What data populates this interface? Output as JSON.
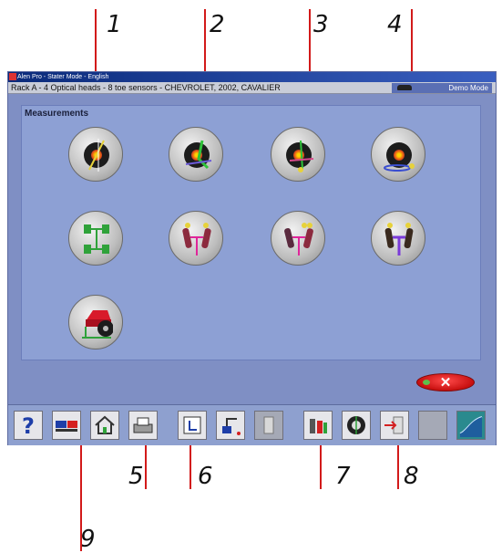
{
  "callouts": [
    "1",
    "2",
    "3",
    "4",
    "5",
    "6",
    "7",
    "8",
    "9"
  ],
  "window": {
    "title": "Alen Pro - Stater Mode - English",
    "vehicle": "Rack A - 4 Optical heads - 8 toe sensors - CHEVROLET, 2002, CAVALIER",
    "mode": "Demo Mode"
  },
  "panel": {
    "title": "Measurements"
  },
  "exit_label": "✕",
  "colors": {
    "window_bg": "#7f8fc4",
    "panel_bg": "#8da0d4",
    "exit": "#d41414",
    "leader_line": "#d21a1a"
  },
  "measurement_buttons": [
    {
      "icon": "camber-wheel-icon"
    },
    {
      "icon": "caster-wheel-icon"
    },
    {
      "icon": "toe-wheel-icon"
    },
    {
      "icon": "wheel-height-icon"
    },
    {
      "icon": "axle-layout-icon"
    },
    {
      "icon": "front-alignment-pink-icon"
    },
    {
      "icon": "rear-alignment-pink-icon"
    },
    {
      "icon": "thrust-angle-purple-icon"
    },
    {
      "icon": "ride-height-car-icon"
    }
  ],
  "toolbar": [
    {
      "icon": "help-icon"
    },
    {
      "icon": "vehicle-spec-icon"
    },
    {
      "icon": "home-icon"
    },
    {
      "icon": "print-icon"
    },
    {
      "icon": "measurement-icon"
    },
    {
      "icon": "adjust-icon"
    },
    {
      "icon": "document-icon"
    },
    {
      "icon": "tools-icon"
    },
    {
      "icon": "wheel-target-icon"
    },
    {
      "icon": "export-icon"
    },
    {
      "icon": "blank-icon"
    },
    {
      "icon": "graph-icon"
    }
  ]
}
